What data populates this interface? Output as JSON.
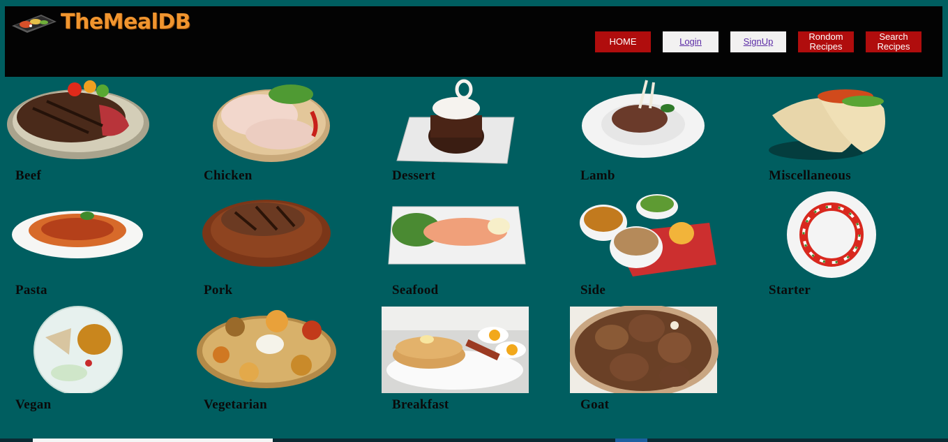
{
  "header": {
    "logo_text": "TheMealDB",
    "nav": [
      {
        "label": "HOME",
        "style": "red"
      },
      {
        "label": "Login",
        "style": "light"
      },
      {
        "label": "SignUp",
        "style": "light"
      },
      {
        "label": "Rondom Recipes",
        "style": "red"
      },
      {
        "label": "Search Recipes",
        "style": "red"
      }
    ]
  },
  "categories": [
    {
      "name": "Beef",
      "icon": "beef-steak-image"
    },
    {
      "name": "Chicken",
      "icon": "chicken-image"
    },
    {
      "name": "Dessert",
      "icon": "dessert-cake-image"
    },
    {
      "name": "Lamb",
      "icon": "lamb-chops-image"
    },
    {
      "name": "Miscellaneous",
      "icon": "tacos-image"
    },
    {
      "name": "Pasta",
      "icon": "pasta-image"
    },
    {
      "name": "Pork",
      "icon": "pork-chop-image"
    },
    {
      "name": "Seafood",
      "icon": "salmon-plate-image"
    },
    {
      "name": "Side",
      "icon": "side-dishes-image"
    },
    {
      "name": "Starter",
      "icon": "caprese-salad-image"
    },
    {
      "name": "Vegan",
      "icon": "vegan-bowl-image"
    },
    {
      "name": "Vegetarian",
      "icon": "thali-image"
    },
    {
      "name": "Breakfast",
      "icon": "pancakes-image"
    },
    {
      "name": "Goat",
      "icon": "goat-curry-image"
    }
  ],
  "colors": {
    "page_bg": "#005e60",
    "header_bg": "#030303",
    "logo_orange": "#f0952f",
    "nav_red": "#b00d0d",
    "nav_light": "#f2f1f1"
  }
}
